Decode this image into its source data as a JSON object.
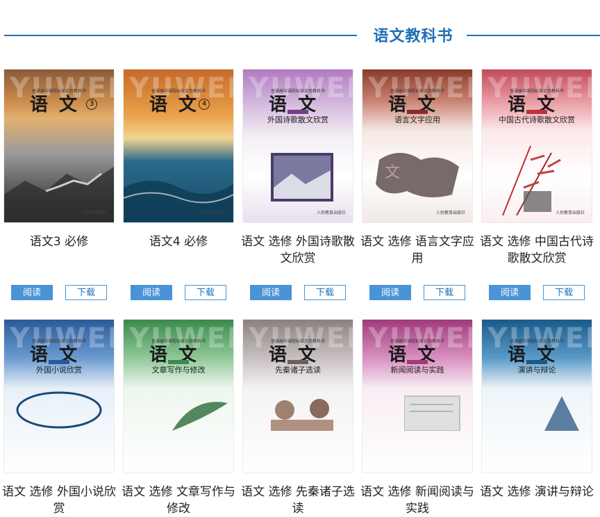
{
  "header": {
    "title": "语文教科书"
  },
  "buttons": {
    "read": "阅读",
    "download": "下载"
  },
  "books_row1": [
    {
      "title": "语文3 必修"
    },
    {
      "title": "语文4 必修"
    },
    {
      "title": "语文 选修 外国诗歌散文欣赏"
    },
    {
      "title": "语文 选修 语言文字应用"
    },
    {
      "title": "语文 选修 中国古代诗歌散文欣赏"
    }
  ],
  "books_row2": [
    {
      "title": "语文 选修 外国小说欣赏"
    },
    {
      "title": "语文 选修 文章写作与修改"
    },
    {
      "title": "语文 选修 先秦诸子选读"
    },
    {
      "title": "语文 选修 新闻阅读与实践"
    },
    {
      "title": "语文 选修 演讲与辩论"
    }
  ],
  "covers": {
    "series": "普通高中课程标准实验教科书",
    "main": "语文",
    "watermark": "YUWEN",
    "publisher": "人民教育出版社",
    "c1_num": "3",
    "c2_num": "4",
    "c3_sub": "外国诗歌散文欣赏",
    "c4_sub": "语言文字应用",
    "c5_sub": "中国古代诗歌散文欣赏",
    "c6_sub": "外国小说欣赏",
    "c7_sub": "文章写作与修改",
    "c8_sub": "先秦诸子选读",
    "c9_sub": "新闻阅读与实践",
    "c10_sub": "演讲与辩论"
  },
  "colors": {
    "accent": "#1f6fb8",
    "button": "#4a93d6"
  }
}
